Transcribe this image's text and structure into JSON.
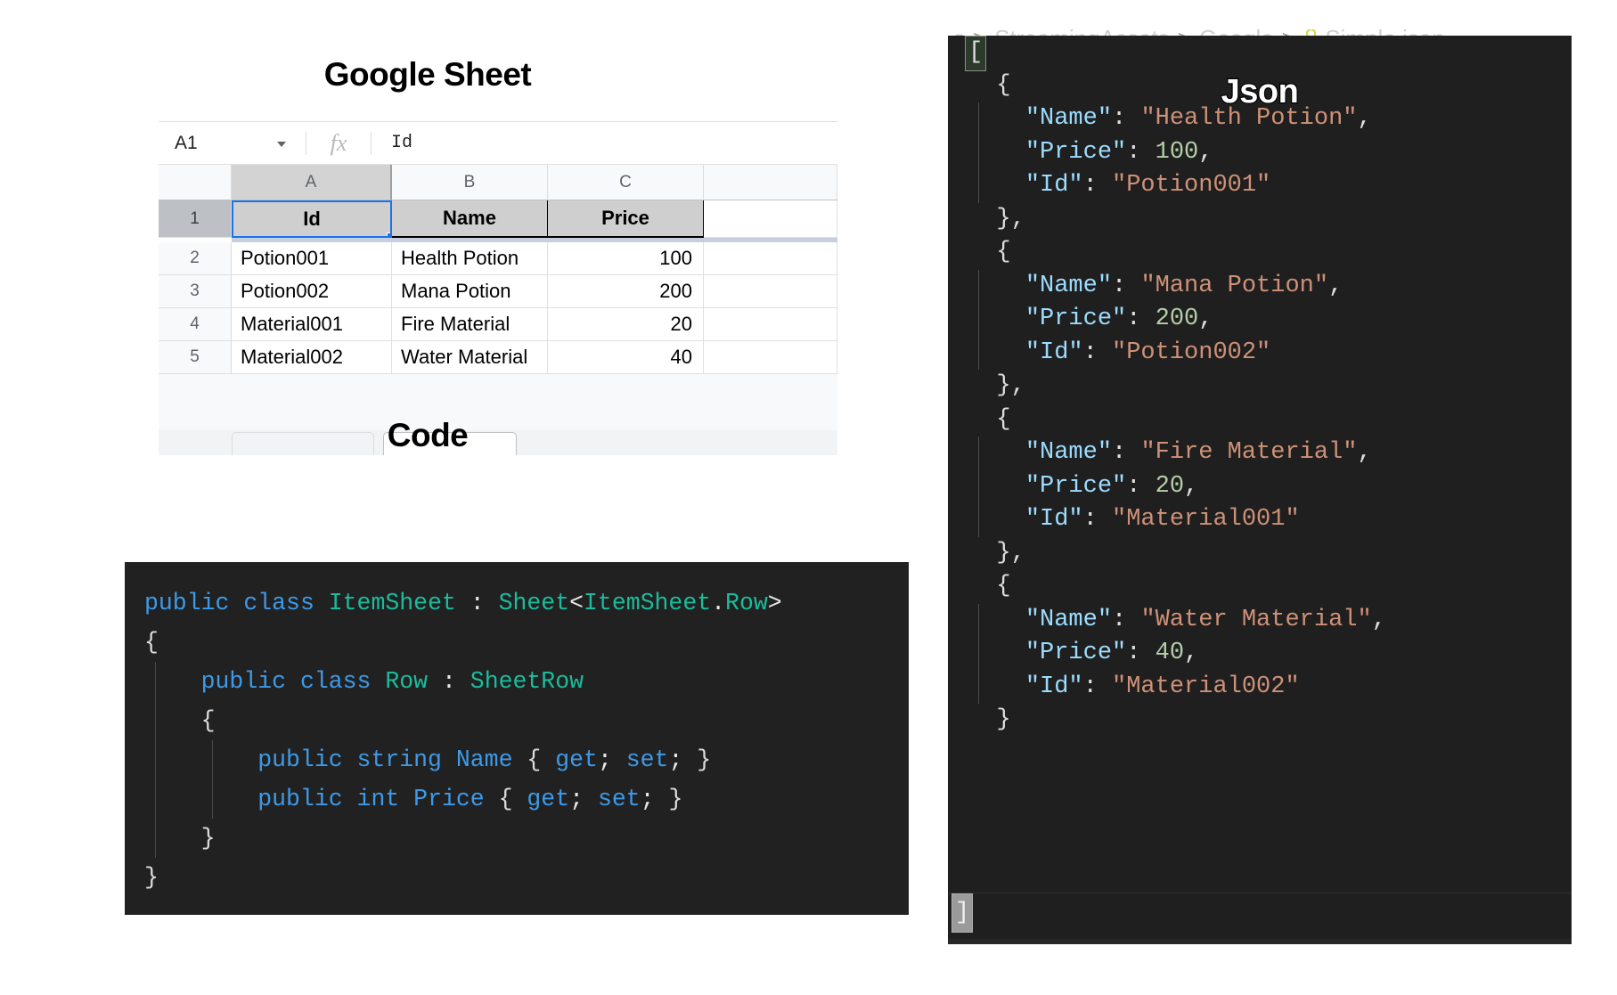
{
  "sheet_section": {
    "title": "Google Sheet",
    "name_box": "A1",
    "fx_label": "fx",
    "formula_value": "Id",
    "column_headers": [
      "",
      "A",
      "B",
      "C",
      ""
    ],
    "header_row": {
      "number": "1",
      "cells": [
        "Id",
        "Name",
        "Price"
      ]
    },
    "rows": [
      {
        "number": "2",
        "id": "Potion001",
        "name": "Health Potion",
        "price": "100"
      },
      {
        "number": "3",
        "id": "Potion002",
        "name": "Mana Potion",
        "price": "200"
      },
      {
        "number": "4",
        "id": "Material001",
        "name": "Fire Material",
        "price": "20"
      },
      {
        "number": "5",
        "id": "Material002",
        "name": "Water Material",
        "price": "40"
      }
    ]
  },
  "code_section": {
    "title": "Code",
    "lines": [
      [
        {
          "t": "public ",
          "c": "kw"
        },
        {
          "t": "class ",
          "c": "kw"
        },
        {
          "t": "ItemSheet",
          "c": "cls"
        },
        {
          "t": " : ",
          "c": "punct"
        },
        {
          "t": "Sheet",
          "c": "cls"
        },
        {
          "t": "<",
          "c": "punct"
        },
        {
          "t": "ItemSheet",
          "c": "cls"
        },
        {
          "t": ".",
          "c": "punct"
        },
        {
          "t": "Row",
          "c": "cls"
        },
        {
          "t": ">",
          "c": "punct"
        }
      ],
      [
        {
          "t": "{",
          "c": "brace"
        }
      ],
      [
        {
          "t": "    public ",
          "c": "kw"
        },
        {
          "t": "class ",
          "c": "kw"
        },
        {
          "t": "Row",
          "c": "cls"
        },
        {
          "t": " : ",
          "c": "punct"
        },
        {
          "t": "SheetRow",
          "c": "cls"
        }
      ],
      [
        {
          "t": "    {",
          "c": "brace"
        }
      ],
      [
        {
          "t": "        public ",
          "c": "kw"
        },
        {
          "t": "string ",
          "c": "kw"
        },
        {
          "t": "Name",
          "c": "member"
        },
        {
          "t": " { ",
          "c": "brace"
        },
        {
          "t": "get",
          "c": "kw"
        },
        {
          "t": "; ",
          "c": "punct"
        },
        {
          "t": "set",
          "c": "kw"
        },
        {
          "t": "; ",
          "c": "punct"
        },
        {
          "t": "}",
          "c": "brace"
        }
      ],
      [
        {
          "t": "        public ",
          "c": "kw"
        },
        {
          "t": "int ",
          "c": "kw"
        },
        {
          "t": "Price",
          "c": "member"
        },
        {
          "t": " { ",
          "c": "brace"
        },
        {
          "t": "get",
          "c": "kw"
        },
        {
          "t": "; ",
          "c": "punct"
        },
        {
          "t": "set",
          "c": "kw"
        },
        {
          "t": "; ",
          "c": "punct"
        },
        {
          "t": "}",
          "c": "brace"
        }
      ],
      [
        {
          "t": "    }",
          "c": "brace"
        }
      ],
      [
        {
          "t": "}",
          "c": "brace"
        }
      ]
    ]
  },
  "json_section": {
    "title": "Json",
    "breadcrumb": {
      "truncated_prefix": "s",
      "parts": [
        "StreamingAssets",
        "Google"
      ],
      "file_icon": "{}",
      "file": "Simple.json"
    },
    "open_bracket": "[",
    "close_bracket": "]",
    "entries": [
      {
        "name": "Health Potion",
        "price": "100",
        "id": "Potion001",
        "trailing_comma": true
      },
      {
        "name": "Mana Potion",
        "price": "200",
        "id": "Potion002",
        "trailing_comma": true
      },
      {
        "name": "Fire Material",
        "price": "20",
        "id": "Material001",
        "trailing_comma": true
      },
      {
        "name": "Water Material",
        "price": "40",
        "id": "Material002",
        "trailing_comma": false
      }
    ],
    "keys": {
      "name": "\"Name\"",
      "price": "\"Price\"",
      "id": "\"Id\""
    }
  },
  "colors": {
    "code_bg": "#212121",
    "json_bg": "#1f1f1f",
    "keyword": "#3d9ae8",
    "type": "#1abc9c",
    "json_key": "#9cdcfe",
    "json_string": "#ce9178",
    "json_number": "#b5cea8",
    "sheet_selection": "#1a73e8"
  }
}
